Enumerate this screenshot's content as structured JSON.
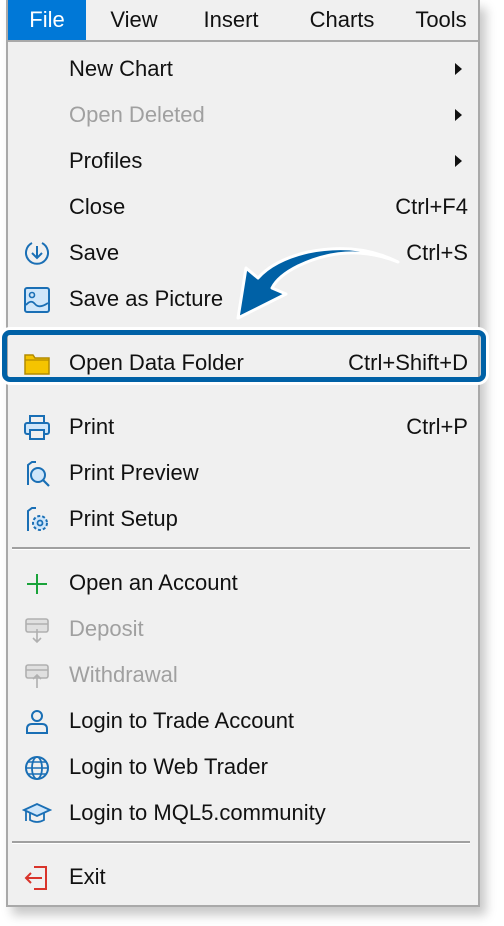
{
  "menubar": {
    "items": [
      {
        "label": "File",
        "active": true
      },
      {
        "label": "View",
        "active": false
      },
      {
        "label": "Insert",
        "active": false
      },
      {
        "label": "Charts",
        "active": false
      },
      {
        "label": "Tools",
        "active": false
      }
    ]
  },
  "file_menu": {
    "items": [
      {
        "label": "New Chart",
        "shortcut": "",
        "submenu": true,
        "enabled": true,
        "icon": "none"
      },
      {
        "label": "Open Deleted",
        "shortcut": "",
        "submenu": true,
        "enabled": false,
        "icon": "none"
      },
      {
        "label": "Profiles",
        "shortcut": "",
        "submenu": true,
        "enabled": true,
        "icon": "none"
      },
      {
        "label": "Close",
        "shortcut": "Ctrl+F4",
        "submenu": false,
        "enabled": true,
        "icon": "none"
      },
      {
        "label": "Save",
        "shortcut": "Ctrl+S",
        "submenu": false,
        "enabled": true,
        "icon": "save-icon"
      },
      {
        "label": "Save as Picture",
        "shortcut": "",
        "submenu": false,
        "enabled": true,
        "icon": "picture-icon"
      },
      {
        "label": "Open Data Folder",
        "shortcut": "Ctrl+Shift+D",
        "submenu": false,
        "enabled": true,
        "icon": "folder-icon",
        "highlighted": true
      },
      {
        "label": "Print",
        "shortcut": "Ctrl+P",
        "submenu": false,
        "enabled": true,
        "icon": "printer-icon"
      },
      {
        "label": "Print Preview",
        "shortcut": "",
        "submenu": false,
        "enabled": true,
        "icon": "print-preview-icon"
      },
      {
        "label": "Print Setup",
        "shortcut": "",
        "submenu": false,
        "enabled": true,
        "icon": "print-setup-icon"
      },
      {
        "label": "Open an Account",
        "shortcut": "",
        "submenu": false,
        "enabled": true,
        "icon": "plus-icon"
      },
      {
        "label": "Deposit",
        "shortcut": "",
        "submenu": false,
        "enabled": false,
        "icon": "deposit-icon"
      },
      {
        "label": "Withdrawal",
        "shortcut": "",
        "submenu": false,
        "enabled": false,
        "icon": "withdrawal-icon"
      },
      {
        "label": "Login to Trade Account",
        "shortcut": "",
        "submenu": false,
        "enabled": true,
        "icon": "user-icon"
      },
      {
        "label": "Login to Web Trader",
        "shortcut": "",
        "submenu": false,
        "enabled": true,
        "icon": "globe-icon"
      },
      {
        "label": "Login to MQL5.community",
        "shortcut": "",
        "submenu": false,
        "enabled": true,
        "icon": "graduation-cap-icon"
      },
      {
        "label": "Exit",
        "shortcut": "",
        "submenu": false,
        "enabled": true,
        "icon": "exit-icon"
      }
    ]
  },
  "annotation": {
    "arrow_color": "#0061a6",
    "highlight_color": "#0061a6",
    "target": "Open Data Folder"
  },
  "colors": {
    "menu_active_bg": "#0078d7",
    "menu_bg": "#f0f0f0",
    "icon_blue": "#1a6fb5",
    "folder_yellow": "#f5c400",
    "plus_green": "#1aa33a",
    "exit_red": "#d9342b",
    "disabled_text": "#a0a0a0"
  }
}
